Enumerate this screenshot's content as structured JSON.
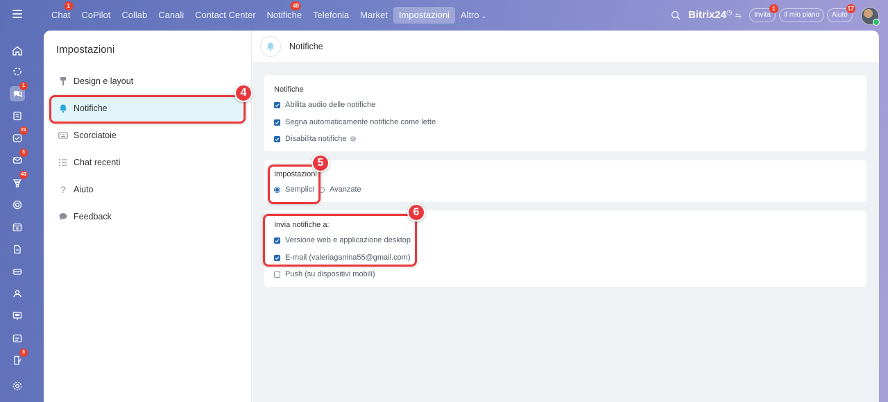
{
  "topnav": {
    "items": [
      {
        "label": "Chat",
        "badge": "1"
      },
      {
        "label": "CoPilot",
        "badge": ""
      },
      {
        "label": "Collab",
        "badge": ""
      },
      {
        "label": "Canali",
        "badge": ""
      },
      {
        "label": "Contact Center",
        "badge": ""
      },
      {
        "label": "Notifiche",
        "badge": "49"
      },
      {
        "label": "Telefonia",
        "badge": ""
      },
      {
        "label": "Market",
        "badge": ""
      },
      {
        "label": "Impostazioni",
        "badge": ""
      },
      {
        "label": "Altro",
        "badge": ""
      }
    ],
    "active_index": 8,
    "brand_name": "Bitrix",
    "brand_number": "24",
    "invite_label": "Invita",
    "invite_badge": "1",
    "plan_label": "Il mio piano",
    "help_label": "Aiuto",
    "help_badge": "17"
  },
  "rail": {
    "badges": {
      "chat": "1",
      "tasks": "21",
      "mail": "3",
      "feed": "43",
      "docs": "3"
    }
  },
  "sidebar": {
    "title": "Impostazioni",
    "items": [
      {
        "label": "Design e layout",
        "icon": "brush-icon"
      },
      {
        "label": "Notifiche",
        "icon": "bell-icon"
      },
      {
        "label": "Scorciatoie",
        "icon": "keyboard-icon"
      },
      {
        "label": "Chat recenti",
        "icon": "list-icon"
      },
      {
        "label": "Aiuto",
        "icon": "question-icon"
      },
      {
        "label": "Feedback",
        "icon": "speech-bubble-icon"
      }
    ],
    "active_index": 1
  },
  "content": {
    "header_title": "Notifiche",
    "notifications_card": {
      "title": "Notifiche",
      "options": [
        {
          "label": "Abilita audio delle notifiche",
          "checked": true
        },
        {
          "label": "Segna automaticamente notifiche come lette",
          "checked": true
        },
        {
          "label": "Disabilita notifiche",
          "checked": true
        }
      ]
    },
    "mode_card": {
      "title": "Impostazioni",
      "options": [
        {
          "label": "Semplici",
          "selected": true
        },
        {
          "label": "Avanzate",
          "selected": false
        }
      ]
    },
    "send_card": {
      "title": "Invia notifiche a:",
      "options": [
        {
          "label": "Versione web e applicazione desktop",
          "checked": true
        },
        {
          "label": "E-mail (valeriaganina55@gmail.com)",
          "checked": true
        },
        {
          "label": "Push (su dispositivi mobili)",
          "checked": false
        }
      ]
    }
  },
  "callouts": [
    "4",
    "5",
    "6"
  ],
  "colors": {
    "accent": "#2067b0",
    "callout": "#e8383d",
    "badge": "#e8402f",
    "active_menu_bg": "#e1f4fa"
  }
}
